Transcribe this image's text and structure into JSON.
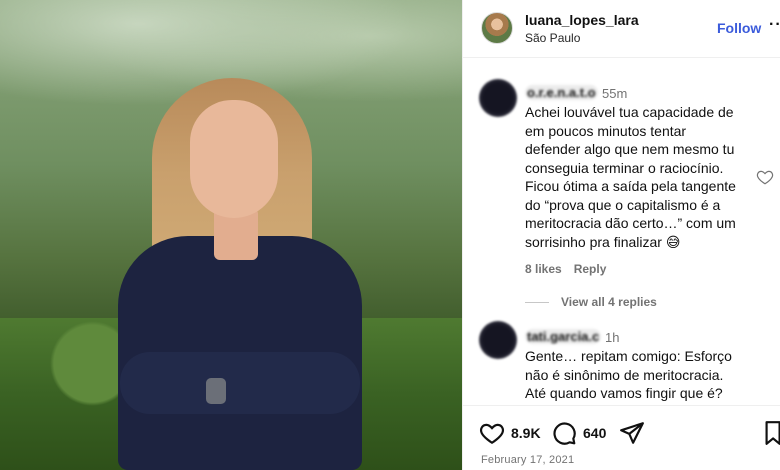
{
  "post": {
    "username": "luana_lopes_lara",
    "location": "São Paulo",
    "follow_label": "Follow",
    "more_label": "···",
    "date": "February 17, 2021"
  },
  "comments": [
    {
      "username": "o.r.e.n.a.t.o",
      "time": "55m",
      "lines": [
        "Achei louvável tua capacidade de",
        "em poucos minutos tentar",
        "defender algo que nem mesmo tu",
        "conseguia terminar o raciocínio.",
        "Ficou ótima a saída pela tangente",
        "do “prova que o capitalismo é a",
        "meritocracia dão certo…” com um",
        "sorrisinho pra finalizar 😅"
      ],
      "likes": "8 likes",
      "reply": "Reply",
      "view_replies": "View all 4 replies"
    },
    {
      "username": "tati.garcia.c",
      "time": "1h",
      "lines": [
        "Gente… repitam comigo: Esforço",
        "não é sinônimo de meritocracia.",
        "Até quando vamos fingir que é?"
      ]
    }
  ],
  "actions": {
    "like_count": "8.9K",
    "comment_count": "640"
  },
  "colors": {
    "follow": "#3b5bdb",
    "muted": "#737373"
  }
}
